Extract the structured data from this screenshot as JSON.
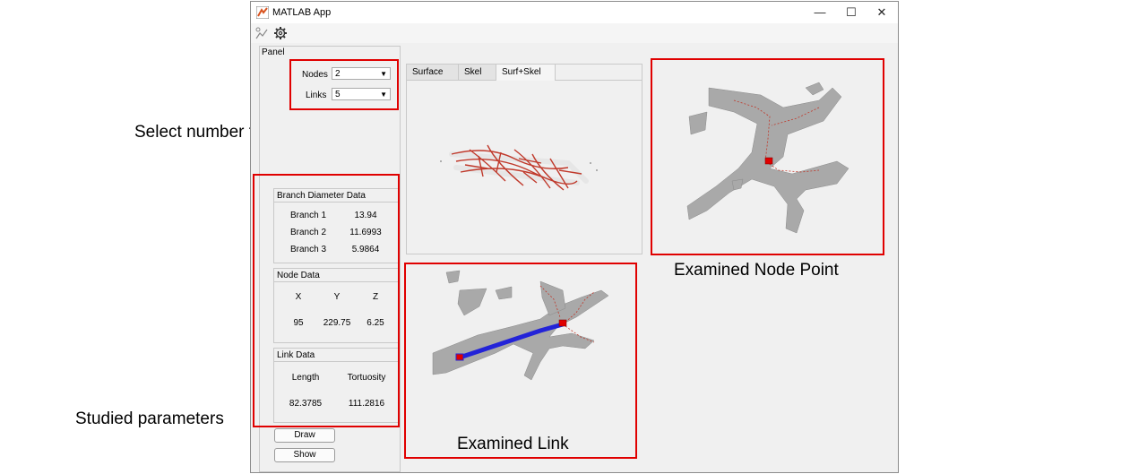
{
  "annotations": {
    "select_number": "Select number  to be examined",
    "studied_parameters": "Studied parameters",
    "examined_node_point": "Examined  Node Point",
    "examined_link": "Examined  Link"
  },
  "window": {
    "title": "MATLAB App",
    "controls": {
      "minimize": "—",
      "maximize": "☐",
      "close": "✕"
    }
  },
  "toolbar": {
    "icons": [
      "plot-tool-icon",
      "gear-icon"
    ]
  },
  "panel": {
    "title": "Panel",
    "nodes_label": "Nodes",
    "nodes_value": "2",
    "links_label": "Links",
    "links_value": "5",
    "branch_diameter": {
      "title": "Branch Diameter Data",
      "rows": [
        {
          "name": "Branch 1",
          "value": "13.94"
        },
        {
          "name": "Branch 2",
          "value": "11.6993"
        },
        {
          "name": "Branch 3",
          "value": "5.9864"
        }
      ]
    },
    "node_data": {
      "title": "Node Data",
      "headers": [
        "X",
        "Y",
        "Z"
      ],
      "values": [
        "95",
        "229.75",
        "6.25"
      ]
    },
    "link_data": {
      "title": "Link Data",
      "headers": [
        "Length",
        "Tortuosity"
      ],
      "values": [
        "82.3785",
        "111.2816"
      ]
    },
    "draw_label": "Draw",
    "show_label": "Show"
  },
  "tabs": [
    {
      "label": "Surface"
    },
    {
      "label": "Skel"
    },
    {
      "label": "Surf+Skel"
    }
  ],
  "colors": {
    "highlight_box": "#e00000",
    "skeleton": "#c0392b",
    "link": "#2323d8",
    "surface": "#a9a9a9"
  }
}
